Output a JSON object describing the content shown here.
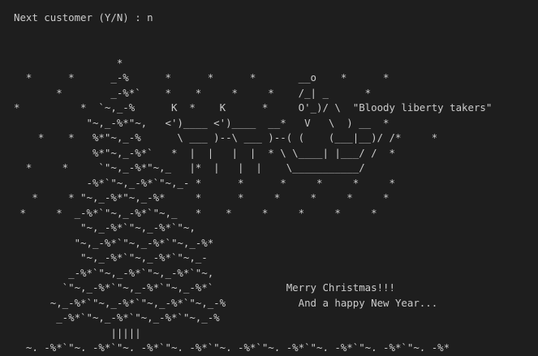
{
  "terminal": {
    "lines": [
      "Next customer (Y/N) : n",
      "",
      "",
      "                 *",
      "  *      *      _-%      *      *      *       __o    *      *",
      "       *        _-%*`    *    *     *     *    /_| _      *",
      "*          *  `~,_-%      K  *    K      *     O'_)/ \\  \"Bloody liberty takers\"",
      "            \"~,_-%*\"~,   <')____ <')____  __*   V   \\  ) __  *",
      "    *    *   %*\"~,_-%      \\ ___ )--\\ ___ )--( (    (___|__)/ /*     *",
      "             %*\"~,_-%*`   *  |  |   |  |  * \\ \\____| |___/ /  *",
      "  *     *     `\"~,_-%*\"~,_   |*  |   |  |    \\___________/",
      "            -%*`\"~,_-%*`\"~,_- *      *      *     *     *     *",
      "   *     * \"~,_-%*\"~,_-%*     *      *     *     *     *     *",
      " *     *  _-%*`\"~,_-%*`\"~,_   *    *     *     *     *     *",
      "           \"~,_-%*`\"~,_-%*`\"~,",
      "          \"~,_-%*`\"~,_-%*`\"~,_-%*",
      "           \"~,_-%*`\"~,_-%*`\"~,_-",
      "         _-%*`\"~,_-%*`\"~,_-%*`\"~,",
      "        `\"~,_-%*`\"~,_-%*`\"~,_-%*`            Merry Christmas!!!",
      "      ~,_-%*`\"~,_-%*`\"~,_-%*`\"~,_-%            And a happy New Year...",
      "       _-%*`\"~,_-%*`\"~,_-%*`\"~,_-%",
      "                |||||",
      "  ~,_-%*`\"~,_-%*`\"~,_-%*`\"~,_-%*`\"~,_-%*`\"~,_-%*`\"~,_-%*`\"~,_-%*`\"~,_-%*"
    ]
  }
}
